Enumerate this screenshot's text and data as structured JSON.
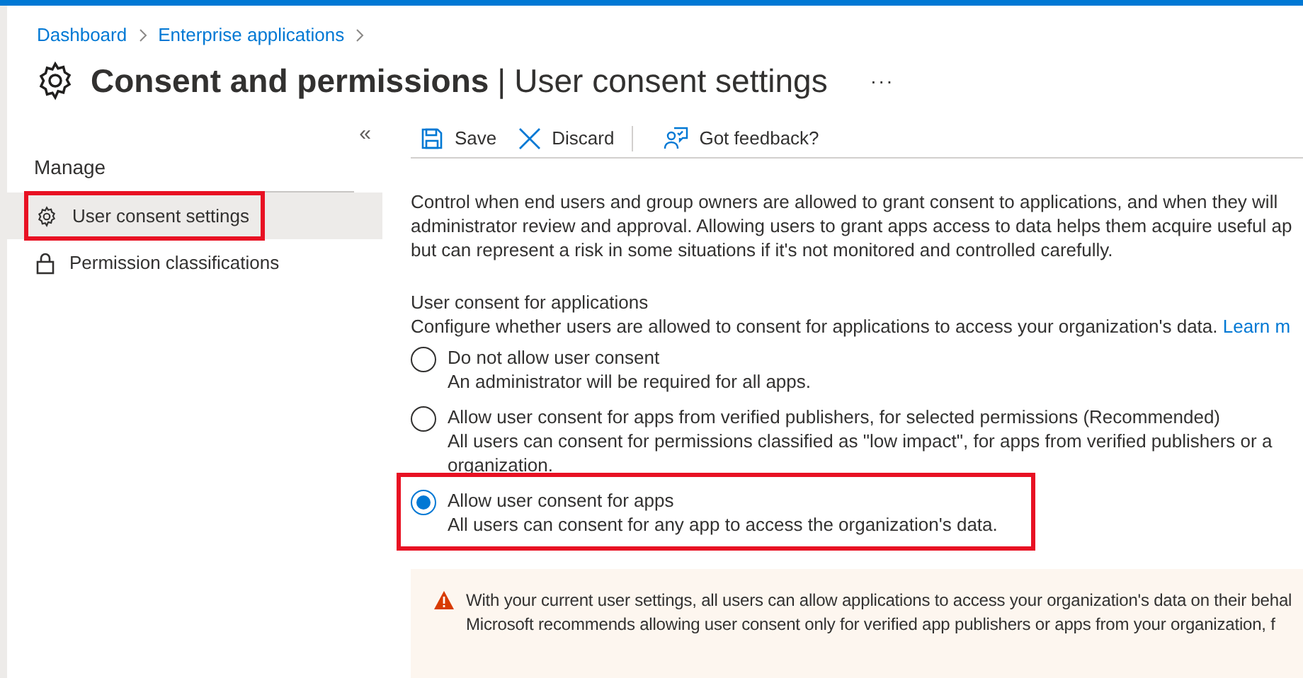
{
  "breadcrumb": [
    {
      "label": "Dashboard"
    },
    {
      "label": "Enterprise applications"
    }
  ],
  "title": {
    "main": "Consent and permissions",
    "separator": "|",
    "sub": "User consent settings",
    "more": "···"
  },
  "sidebar": {
    "collapse": "«",
    "section": "Manage",
    "items": [
      {
        "label": "User consent settings",
        "selected": true,
        "highlighted": true
      },
      {
        "label": "Permission classifications",
        "selected": false,
        "highlighted": false
      }
    ]
  },
  "toolbar": [
    {
      "label": "Save"
    },
    {
      "label": "Discard"
    },
    {
      "label": "Got feedback?"
    }
  ],
  "description": [
    "Control when end users and group owners are allowed to grant consent to applications, and when they will",
    "administrator review and approval. Allowing users to grant apps access to data helps them acquire useful ap",
    "but can represent a risk in some situations if it's not monitored and controlled carefully."
  ],
  "consent": {
    "heading": "User consent for applications",
    "intro": "Configure whether users are allowed to consent for applications to access your organization's data.",
    "link": "Learn m",
    "options": [
      {
        "label": "Do not allow user consent",
        "details": [
          "An administrator will be required for all apps."
        ],
        "selected": false,
        "highlighted": false
      },
      {
        "label": "Allow user consent for apps from verified publishers, for selected permissions (Recommended)",
        "details": [
          "All users can consent for permissions classified as \"low impact\", for apps from verified publishers or a",
          "organization."
        ],
        "selected": false,
        "highlighted": false
      },
      {
        "label": "Allow user consent for apps",
        "details": [
          "All users can consent for any app to access the organization's data."
        ],
        "selected": true,
        "highlighted": true
      }
    ]
  },
  "warning": {
    "lines": [
      "With your current user settings, all users can allow applications to access your organization's data on their behal",
      "Microsoft recommends allowing user consent only for verified app publishers or apps from your organization, f"
    ]
  }
}
